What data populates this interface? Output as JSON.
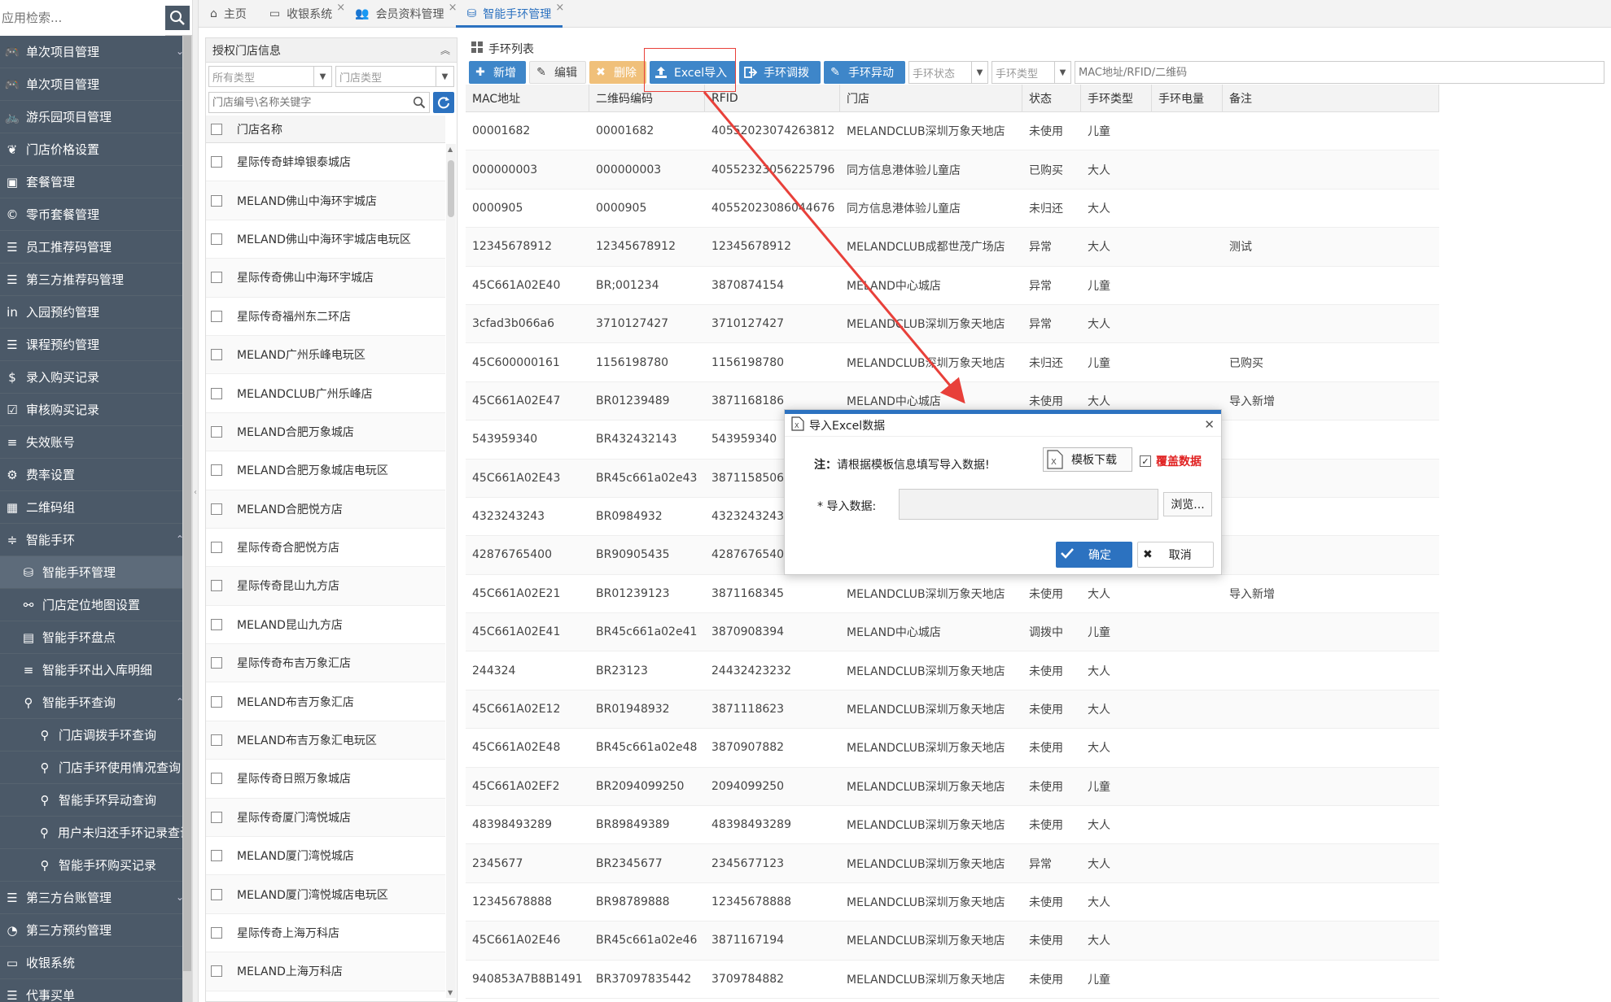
{
  "sidebar": {
    "search_placeholder": "应用检索...",
    "items": [
      {
        "label": "单次项目管理",
        "icon": "gamepad-icon",
        "arrow": true,
        "level": 0
      },
      {
        "label": "单次项目管理",
        "icon": "gamepad-icon",
        "level": 0
      },
      {
        "label": "游乐园项目管理",
        "icon": "bicycle-icon",
        "level": 0
      },
      {
        "label": "门店价格设置",
        "icon": "leaf-icon",
        "level": 0
      },
      {
        "label": "套餐管理",
        "icon": "briefcase-icon",
        "level": 0
      },
      {
        "label": "零币套餐管理",
        "icon": "copyright-icon",
        "level": 0
      },
      {
        "label": "员工推荐码管理",
        "icon": "list-alt-icon",
        "level": 0
      },
      {
        "label": "第三方推荐码管理",
        "icon": "list-alt-icon",
        "level": 0
      },
      {
        "label": "入园预约管理",
        "icon": "linkedin-icon",
        "level": 0
      },
      {
        "label": "课程预约管理",
        "icon": "list-alt-icon",
        "level": 0
      },
      {
        "label": "录入购买记录",
        "icon": "dollar-icon",
        "level": 0
      },
      {
        "label": "审核购买记录",
        "icon": "check-square-icon",
        "level": 0
      },
      {
        "label": "失效账号",
        "icon": "list-icon",
        "level": 0
      },
      {
        "label": "费率设置",
        "icon": "gear-icon",
        "level": 0
      },
      {
        "label": "二维码组",
        "icon": "qrcode-icon",
        "level": 0
      },
      {
        "label": "智能手环",
        "icon": "sliders-icon",
        "arrow": true,
        "level": 0
      },
      {
        "label": "智能手环管理",
        "icon": "database-icon",
        "level": 1,
        "active": true
      },
      {
        "label": "门店定位地图设置",
        "icon": "link-icon",
        "level": 1
      },
      {
        "label": "智能手环盘点",
        "icon": "calculator-icon",
        "level": 1
      },
      {
        "label": "智能手环出入库明细",
        "icon": "list-icon",
        "level": 1
      },
      {
        "label": "智能手环查询",
        "icon": "search-icon",
        "arrow": true,
        "level": 1
      },
      {
        "label": "门店调拨手环查询",
        "icon": "search-icon",
        "level": 2
      },
      {
        "label": "门店手环使用情况查询",
        "icon": "search-icon",
        "level": 2
      },
      {
        "label": "智能手环异动查询",
        "icon": "search-icon",
        "level": 2
      },
      {
        "label": "用户未归还手环记录查询",
        "icon": "search-icon",
        "level": 2
      },
      {
        "label": "智能手环购买记录",
        "icon": "search-icon",
        "level": 2
      },
      {
        "label": "第三方台账管理",
        "icon": "list-alt-icon",
        "arrow": true,
        "level": 0
      },
      {
        "label": "第三方预约管理",
        "icon": "clock-icon",
        "level": 0
      },
      {
        "label": "收银系统",
        "icon": "laptop-icon",
        "level": 0
      },
      {
        "label": "代事买单",
        "icon": "list-alt-icon",
        "level": 0
      }
    ]
  },
  "tabs": [
    {
      "label": "主页",
      "icon": "home-icon"
    },
    {
      "label": "收银系统",
      "icon": "laptop-icon",
      "closable": true
    },
    {
      "label": "会员资料管理",
      "icon": "users-icon",
      "closable": true
    },
    {
      "label": "智能手环管理",
      "icon": "database-icon",
      "closable": true,
      "active": true
    }
  ],
  "store_panel": {
    "title": "授权门店信息",
    "type_placeholder": "所有类型",
    "store_type_placeholder": "门店类型",
    "search_placeholder": "门店编号\\名称关键字",
    "column_header": "门店名称",
    "stores": [
      "星际传奇蚌埠银泰城店",
      "MELAND佛山中海环宇城店",
      "MELAND佛山中海环宇城店电玩区",
      "星际传奇佛山中海环宇城店",
      "星际传奇福州东二环店",
      "MELAND广州乐峰电玩区",
      "MELANDCLUB广州乐峰店",
      "MELAND合肥万象城店",
      "MELAND合肥万象城店电玩区",
      "MELAND合肥悦方店",
      "星际传奇合肥悦方店",
      "星际传奇昆山九方店",
      "MELAND昆山九方店",
      "星际传奇布吉万象汇店",
      "MELAND布吉万象汇店",
      "MELAND布吉万象汇电玩区",
      "星际传奇日照万象城店",
      "星际传奇厦门湾悦城店",
      "MELAND厦门湾悦城店",
      "MELAND厦门湾悦城店电玩区",
      "星际传奇上海万科店",
      "MELAND上海万科店"
    ]
  },
  "list_panel": {
    "title": "手环列表",
    "toolbar": {
      "add": "新增",
      "edit": "编辑",
      "delete": "删除",
      "excel_import": "Excel导入",
      "transfer": "手环调拨",
      "abnormal": "手环异动",
      "status_placeholder": "手环状态",
      "type_placeholder": "手环类型",
      "search_placeholder": "MAC地址/RFID/二维码"
    },
    "columns": [
      "MAC地址",
      "二维码编码",
      "RFID",
      "门店",
      "状态",
      "手环类型",
      "手环电量",
      "备注"
    ],
    "rows": [
      [
        "00001682",
        "00001682",
        "40552023074263812",
        "MELANDCLUB深圳万象天地店",
        "未使用",
        "儿童",
        "",
        ""
      ],
      [
        "000000003",
        "000000003",
        "40552323056225796",
        "同方信息港体验儿童店",
        "已购买",
        "大人",
        "",
        ""
      ],
      [
        "0000905",
        "0000905",
        "40552023086044676",
        "同方信息港体验儿童店",
        "未归还",
        "大人",
        "",
        ""
      ],
      [
        "12345678912",
        "12345678912",
        "12345678912",
        "MELANDCLUB成都世茂广场店",
        "异常",
        "大人",
        "",
        "测试"
      ],
      [
        "45C661A02E40",
        "BR;001234",
        "3870874154",
        "MELAND中心城店",
        "异常",
        "儿童",
        "",
        ""
      ],
      [
        "3cfad3b066a6",
        "3710127427",
        "3710127427",
        "MELANDCLUB深圳万象天地店",
        "异常",
        "大人",
        "",
        ""
      ],
      [
        "45C600000161",
        "1156198780",
        "1156198780",
        "MELANDCLUB深圳万象天地店",
        "未归还",
        "儿童",
        "",
        "已购买"
      ],
      [
        "45C661A02E47",
        "BR01239489",
        "3871168186",
        "MELAND中心城店",
        "未使用",
        "大人",
        "",
        "导入新增"
      ],
      [
        "543959340",
        "BR432432143",
        "543959340",
        "",
        "",
        "",
        "",
        ""
      ],
      [
        "45C661A02E43",
        "BR45c661a02e43",
        "3871158506",
        "",
        "",
        "",
        "",
        ""
      ],
      [
        "4323243243",
        "BR0984932",
        "4323243243",
        "",
        "",
        "",
        "",
        ""
      ],
      [
        "42876765400",
        "BR90905435",
        "42876765400",
        "",
        "",
        "",
        "",
        ""
      ],
      [
        "45C661A02E21",
        "BR01239123",
        "3871168345",
        "MELANDCLUB深圳万象天地店",
        "未使用",
        "大人",
        "",
        "导入新增"
      ],
      [
        "45C661A02E41",
        "BR45c661a02e41",
        "3870908394",
        "MELAND中心城店",
        "调拨中",
        "儿童",
        "",
        ""
      ],
      [
        "244324",
        "BR23123",
        "24432423232",
        "MELANDCLUB深圳万象天地店",
        "未使用",
        "大人",
        "",
        ""
      ],
      [
        "45C661A02E12",
        "BR01948932",
        "3871118623",
        "MELANDCLUB深圳万象天地店",
        "未使用",
        "大人",
        "",
        ""
      ],
      [
        "45C661A02E48",
        "BR45c661a02e48",
        "3870907882",
        "MELANDCLUB深圳万象天地店",
        "未使用",
        "大人",
        "",
        ""
      ],
      [
        "45C661A02EF2",
        "BR2094099250",
        "2094099250",
        "MELANDCLUB深圳万象天地店",
        "未使用",
        "儿童",
        "",
        ""
      ],
      [
        "48398493289",
        "BR89849389",
        "48398493289",
        "MELANDCLUB深圳万象天地店",
        "未使用",
        "大人",
        "",
        ""
      ],
      [
        "2345677",
        "BR2345677",
        "2345677123",
        "MELANDCLUB深圳万象天地店",
        "异常",
        "大人",
        "",
        ""
      ],
      [
        "12345678888",
        "BR98789888",
        "12345678888",
        "MELANDCLUB深圳万象天地店",
        "未使用",
        "大人",
        "",
        ""
      ],
      [
        "45C661A02E46",
        "BR45c661a02e46",
        "3871167194",
        "MELANDCLUB深圳万象天地店",
        "未使用",
        "大人",
        "",
        ""
      ],
      [
        "940853A7B8B1491",
        "BR37097835442",
        "3709784882",
        "MELANDCLUB深圳万象天地店",
        "未使用",
        "儿童",
        "",
        ""
      ]
    ]
  },
  "modal": {
    "title": "导入Excel数据",
    "note_prefix": "注：",
    "note_text": "请根据模板信息填写导入数据!",
    "template_button": "模板下载",
    "overwrite_label": "覆盖数据",
    "import_label": "* 导入数据:",
    "browse_button": "浏览...",
    "ok_button": "确定",
    "cancel_button": "取消"
  },
  "colors": {
    "sidebar_bg": "#4b5968",
    "primary": "#2c72c0",
    "annotation_red": "#e8403a",
    "overwrite_red": "#e02020"
  }
}
